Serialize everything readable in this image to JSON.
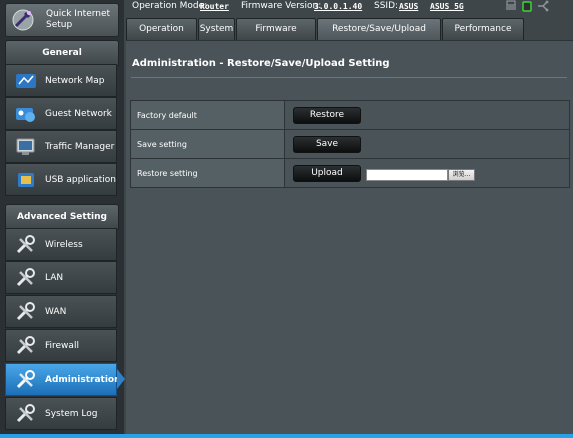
{
  "sidebar": {
    "quick_setup": {
      "label": "Quick Internet Setup",
      "icon": "wizard-icon"
    },
    "general_header": "General",
    "general_items": [
      {
        "label": "Network Map",
        "icon": "network-map-icon"
      },
      {
        "label": "Guest Network",
        "icon": "guest-network-icon"
      },
      {
        "label": "Traffic Manager",
        "icon": "traffic-manager-icon"
      },
      {
        "label": "USB application",
        "icon": "usb-application-icon"
      }
    ],
    "advanced_header": "Advanced Setting",
    "advanced_items": [
      {
        "label": "Wireless",
        "icon": "tools-icon"
      },
      {
        "label": "LAN",
        "icon": "tools-icon"
      },
      {
        "label": "WAN",
        "icon": "tools-icon"
      },
      {
        "label": "Firewall",
        "icon": "tools-icon"
      },
      {
        "label": "Administration",
        "icon": "tools-icon",
        "active": true
      },
      {
        "label": "System Log",
        "icon": "tools-icon"
      }
    ]
  },
  "status": {
    "operation_mode_label": "Operation Mode:",
    "operation_mode_value": "Router",
    "firmware_label": "Firmware Version:",
    "firmware_value": "3.0.0.1.40",
    "ssid_label": "SSID:",
    "ssid_value_1": "ASUS",
    "ssid_value_2": "ASUS_5G",
    "icons": [
      "printer-icon",
      "usb-device-icon",
      "network-status-icon"
    ]
  },
  "tabs": [
    {
      "label": "Operation Mode"
    },
    {
      "label": "System"
    },
    {
      "label": "Firmware Upgrade"
    },
    {
      "label": "Restore/Save/Upload Setting",
      "active": true
    },
    {
      "label": "Performance tuning"
    }
  ],
  "main": {
    "title": "Administration - Restore/Save/Upload Setting",
    "rows": [
      {
        "label": "Factory default",
        "button": "Restore"
      },
      {
        "label": "Save setting",
        "button": "Save"
      },
      {
        "label": "Restore setting",
        "button": "Upload",
        "file_value": "",
        "browse_label": "浏览..."
      }
    ]
  },
  "colors": {
    "active_accent": "#2f80c9",
    "background": "#4a5357",
    "bottom_bar": "#26a2e6"
  }
}
